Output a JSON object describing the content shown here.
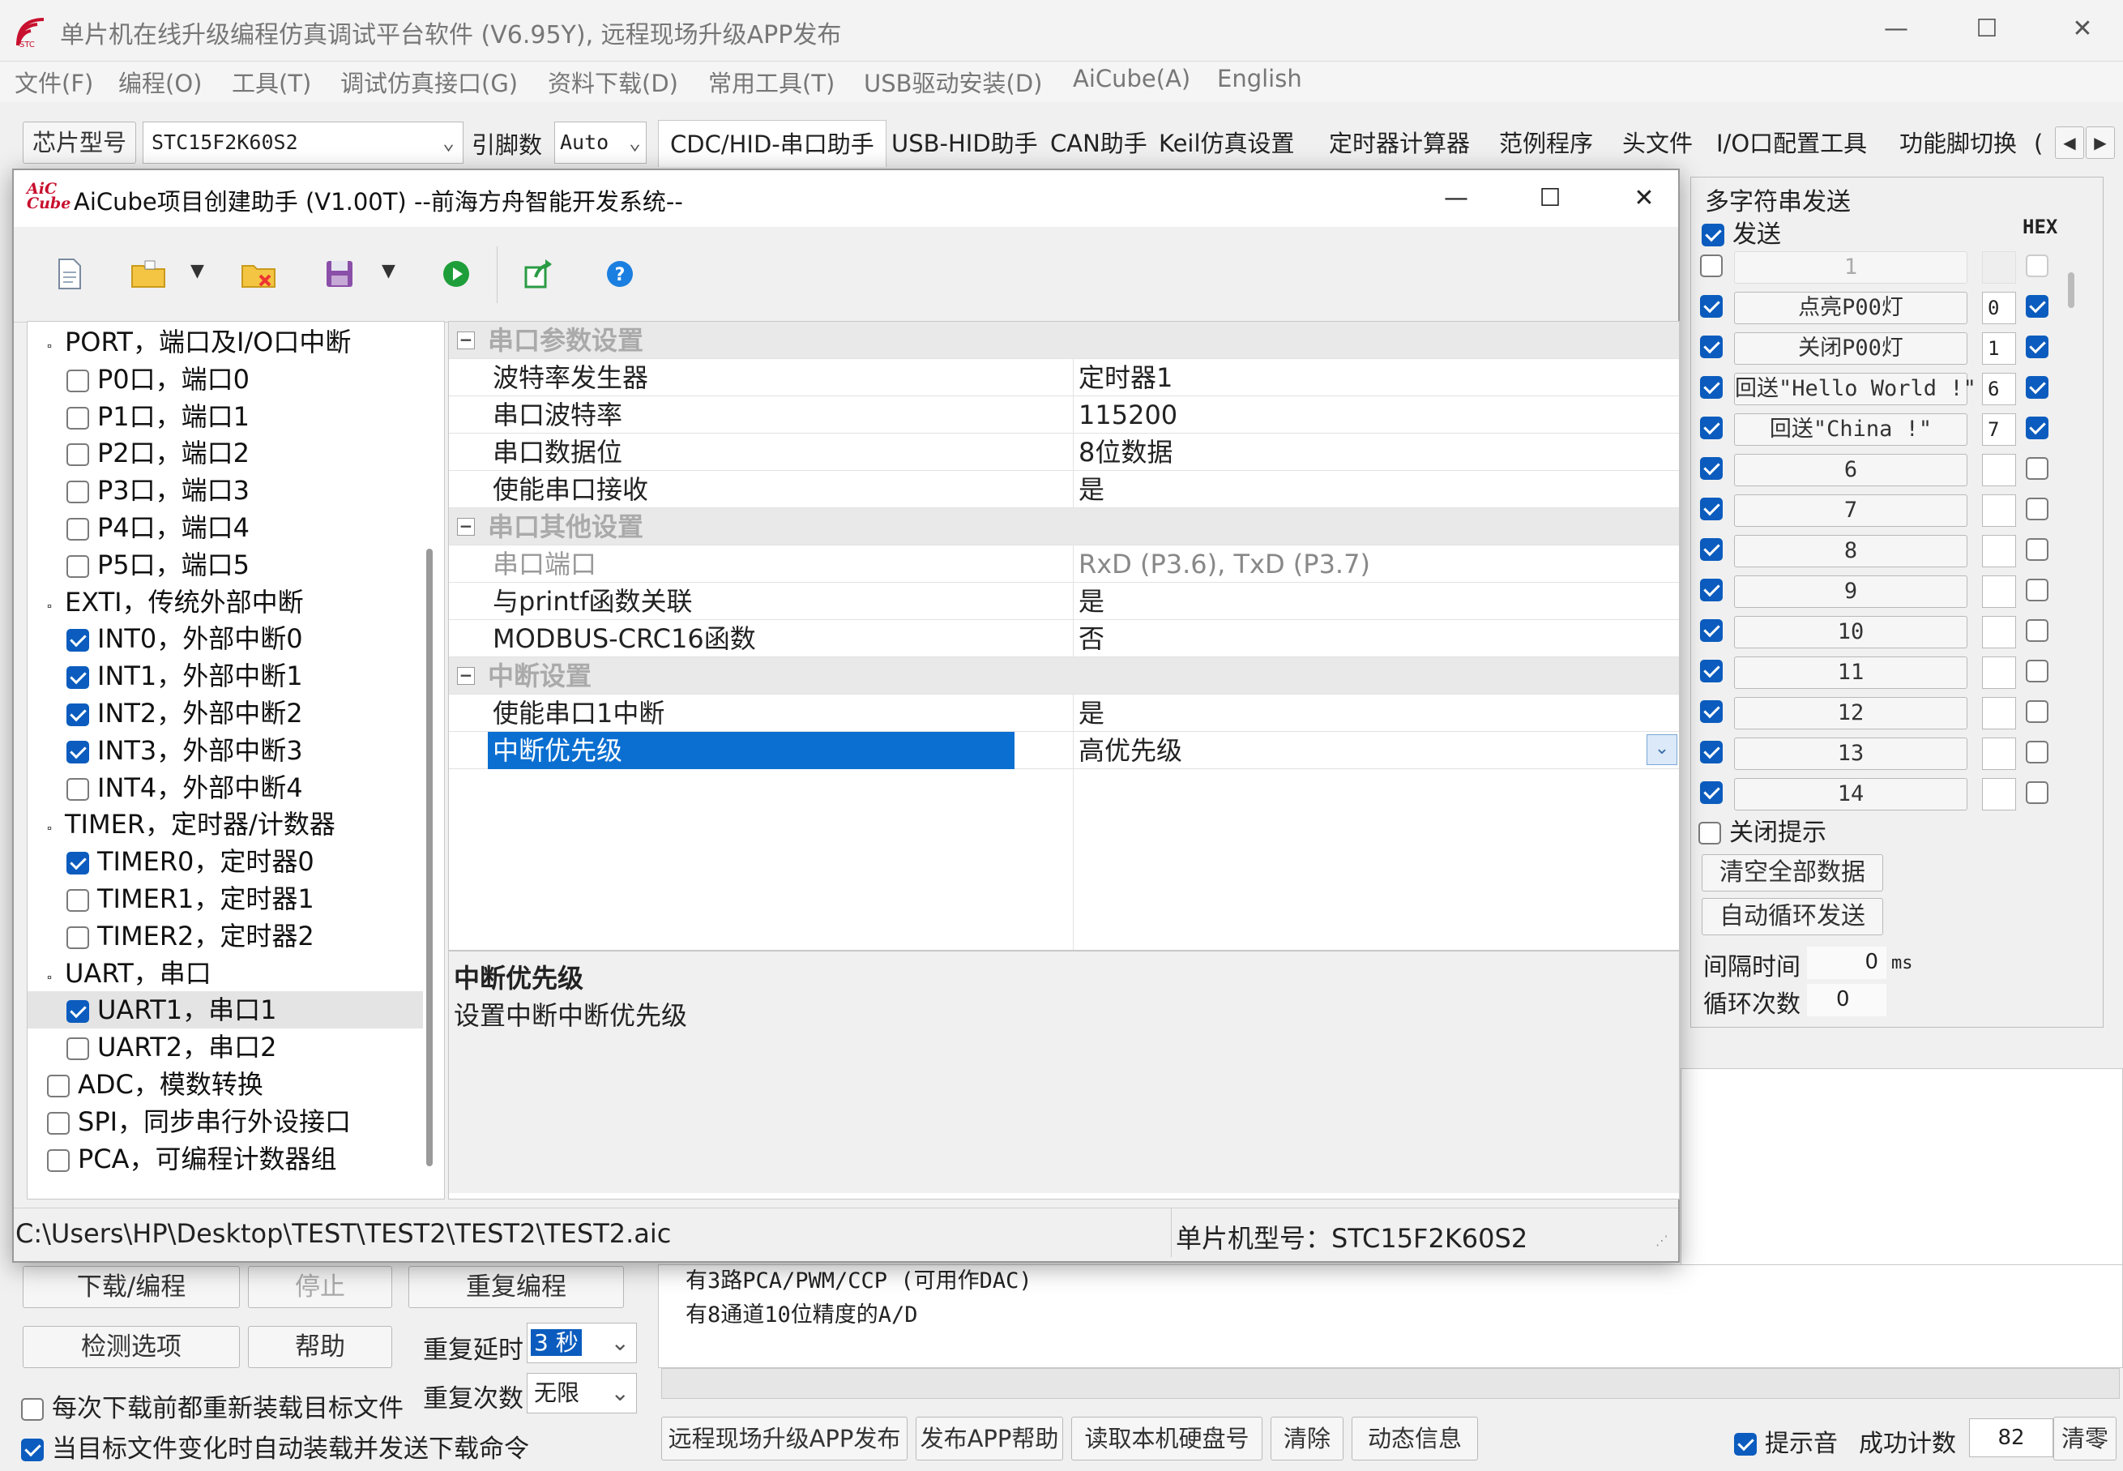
{
  "window": {
    "title": "单片机在线升级编程仿真调试平台软件 (V6.95Y), 远程现场升级APP发布",
    "minimize": "—",
    "maximize": "☐",
    "close": "✕"
  },
  "menu": [
    "文件(F)",
    "编程(O)",
    "工具(T)",
    "调试仿真接口(G)",
    "资料下载(D)",
    "常用工具(T)",
    "USB驱动安装(D)",
    "AiCube(A)",
    "English"
  ],
  "chip_bar": {
    "chip_label": "芯片型号",
    "chip_value": "STC15F2K60S2",
    "pin_label": "引脚数",
    "pin_value": "Auto"
  },
  "tabs": [
    "CDC/HID-串口助手",
    "USB-HID助手",
    "CAN助手",
    "Keil仿真设置",
    "定时器计算器",
    "范例程序",
    "头文件",
    "I/O口配置工具",
    "功能脚切换",
    "("
  ],
  "dialog": {
    "icon_text": "AiC Cube",
    "title": "AiCube项目创建助手 (V1.00T) --前海方舟智能开发系统--",
    "minimize": "—",
    "maximize": "☐",
    "close": "✕",
    "toolbar": [
      "new-file-icon",
      "open-folder-icon",
      "dropdown-arrow-icon",
      "close-folder-icon",
      "save-icon",
      "dropdown-arrow-icon",
      "run-icon",
      "export-icon",
      "help-icon"
    ],
    "tree": [
      {
        "label": "PORT，端口及I/O口中断",
        "level": 0,
        "group": true
      },
      {
        "label": "P0口，端口0",
        "level": 1,
        "checked": false
      },
      {
        "label": "P1口，端口1",
        "level": 1,
        "checked": false
      },
      {
        "label": "P2口，端口2",
        "level": 1,
        "checked": false
      },
      {
        "label": "P3口，端口3",
        "level": 1,
        "checked": false
      },
      {
        "label": "P4口，端口4",
        "level": 1,
        "checked": false
      },
      {
        "label": "P5口，端口5",
        "level": 1,
        "checked": false
      },
      {
        "label": "EXTI，传统外部中断",
        "level": 0,
        "group": true
      },
      {
        "label": "INT0，外部中断0",
        "level": 1,
        "checked": true
      },
      {
        "label": "INT1，外部中断1",
        "level": 1,
        "checked": true
      },
      {
        "label": "INT2，外部中断2",
        "level": 1,
        "checked": true
      },
      {
        "label": "INT3，外部中断3",
        "level": 1,
        "checked": true
      },
      {
        "label": "INT4，外部中断4",
        "level": 1,
        "checked": false
      },
      {
        "label": "TIMER，定时器/计数器",
        "level": 0,
        "group": true
      },
      {
        "label": "TIMER0，定时器0",
        "level": 1,
        "checked": true
      },
      {
        "label": "TIMER1，定时器1",
        "level": 1,
        "checked": false
      },
      {
        "label": "TIMER2，定时器2",
        "level": 1,
        "checked": false
      },
      {
        "label": "UART，串口",
        "level": 0,
        "group": true
      },
      {
        "label": "UART1，串口1",
        "level": 1,
        "checked": true,
        "selected": true
      },
      {
        "label": "UART2，串口2",
        "level": 1,
        "checked": false
      },
      {
        "label": "ADC，模数转换",
        "level": 0,
        "checked": false
      },
      {
        "label": "SPI，同步串行外设接口",
        "level": 0,
        "checked": false
      },
      {
        "label": "PCA，可编程计数器组",
        "level": 0,
        "checked": false
      }
    ],
    "props": [
      {
        "cat": "串口参数设置"
      },
      {
        "name": "波特率发生器",
        "value": "定时器1"
      },
      {
        "name": "串口波特率",
        "value": "115200"
      },
      {
        "name": "串口数据位",
        "value": "8位数据"
      },
      {
        "name": "使能串口接收",
        "value": "是"
      },
      {
        "cat": "串口其他设置"
      },
      {
        "name": "串口端口",
        "value": "RxD (P3.6), TxD (P3.7)",
        "disabled": true
      },
      {
        "name": "与printf函数关联",
        "value": "是"
      },
      {
        "name": "MODBUS-CRC16函数",
        "value": "否"
      },
      {
        "cat": "中断设置"
      },
      {
        "name": "使能串口1中断",
        "value": "是"
      },
      {
        "name": "中断优先级",
        "value": "高优先级",
        "selected": true
      }
    ],
    "desc_title": "中断优先级",
    "desc_text": "设置中断中断优先级",
    "status_path": "C:\\Users\\HP\\Desktop\\TEST\\TEST2\\TEST2\\TEST2.aic",
    "status_chip": "单片机型号：STC15F2K60S2"
  },
  "right_panel": {
    "title": "多字符串发送",
    "send_label": "发送",
    "hex_label": "HEX",
    "rows": [
      {
        "check": false,
        "label": "1",
        "num": "",
        "hex": false,
        "disabled": true
      },
      {
        "check": true,
        "label": "点亮P00灯",
        "num": "0",
        "hex": true
      },
      {
        "check": true,
        "label": "关闭P00灯",
        "num": "1",
        "hex": true
      },
      {
        "check": true,
        "label": "回送\"Hello World !\"",
        "num": "6",
        "hex": true
      },
      {
        "check": true,
        "label": "回送\"China !\"",
        "num": "7",
        "hex": true
      },
      {
        "check": true,
        "label": "6",
        "num": "",
        "hex": false
      },
      {
        "check": true,
        "label": "7",
        "num": "",
        "hex": false
      },
      {
        "check": true,
        "label": "8",
        "num": "",
        "hex": false
      },
      {
        "check": true,
        "label": "9",
        "num": "",
        "hex": false
      },
      {
        "check": true,
        "label": "10",
        "num": "",
        "hex": false
      },
      {
        "check": true,
        "label": "11",
        "num": "",
        "hex": false
      },
      {
        "check": true,
        "label": "12",
        "num": "",
        "hex": false
      },
      {
        "check": true,
        "label": "13",
        "num": "",
        "hex": false
      },
      {
        "check": true,
        "label": "14",
        "num": "",
        "hex": false
      }
    ],
    "close_tip": "关闭提示",
    "clear_all": "清空全部数据",
    "auto_loop": "自动循环发送",
    "interval_label": "间隔时间",
    "interval_value": "0",
    "interval_unit": "ms",
    "loop_label": "循环次数",
    "loop_value": "0"
  },
  "bottom": {
    "download": "下载/编程",
    "stop": "停止",
    "repeat": "重复编程",
    "check_options": "检测选项",
    "help": "帮助",
    "repeat_delay_label": "重复延时",
    "repeat_delay_value": "3 秒",
    "repeat_count_label": "重复次数",
    "repeat_count_value": "无限",
    "reload_label": "每次下载前都重新装载目标文件",
    "auto_label": "当目标文件变化时自动装载并发送下载命令",
    "info_lines": [
      "有3路PCA/PWM/CCP (可用作DAC)",
      "有8通道10位精度的A/D"
    ],
    "remote_btn": "远程现场升级APP发布",
    "app_help": "发布APP帮助",
    "read_disk": "读取本机硬盘号",
    "clear": "清除",
    "dynamic": "动态信息",
    "sound_label": "提示音",
    "success_label": "成功计数",
    "success_value": "82",
    "clear_count": "清零"
  }
}
